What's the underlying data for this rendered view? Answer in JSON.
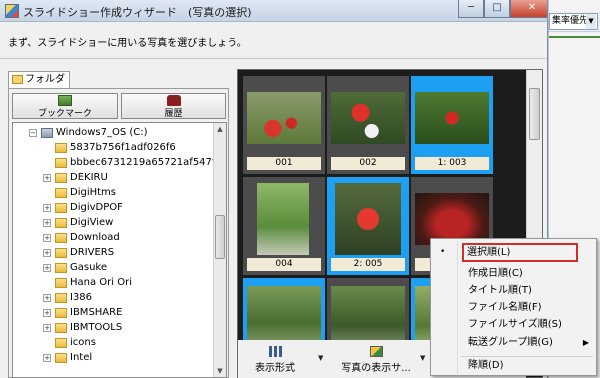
{
  "window": {
    "title": "スライドショー作成ウィザード　(写真の選択)",
    "minimize": "─",
    "restore": "□",
    "close": "✕"
  },
  "instruction": "まず、スライドショーに用いる写真を選びましょう。",
  "left_panel": {
    "tab_label": "フォルダ",
    "bookmark_label": "ブックマーク",
    "history_label": "履歴",
    "tree": {
      "drive": "Windows7_OS (C:)",
      "items": [
        "5837b756f1adf026f6",
        "bbbec6731219a65721af547f",
        "DEKIRU",
        "DigiHtms",
        "DigivDPOF",
        "DigiView",
        "Download",
        "DRIVERS",
        "Gasuke",
        "Hana Ori Ori",
        "I386",
        "IBMSHARE",
        "IBMTOOLS",
        "icons",
        "Intel"
      ]
    }
  },
  "photos": [
    {
      "caption": "001",
      "selected": false
    },
    {
      "caption": "002",
      "selected": false
    },
    {
      "caption": "1: 003",
      "selected": true
    },
    {
      "caption": "004",
      "selected": false
    },
    {
      "caption": "2: 005",
      "selected": true
    },
    {
      "caption": "",
      "selected": false
    },
    {
      "caption": "",
      "selected": true
    },
    {
      "caption": "",
      "selected": false
    },
    {
      "caption": "",
      "selected": true
    }
  ],
  "bottom_bar": {
    "view_mode_label": "表示形式",
    "photo_display_label": "写真の表示サ..."
  },
  "context_menu": {
    "items": [
      {
        "label": "選択順(L)",
        "bullet": "•",
        "highlighted": true
      },
      {
        "label": "作成日順(C)"
      },
      {
        "label": "タイトル順(T)"
      },
      {
        "label": "ファイル名順(F)"
      },
      {
        "label": "ファイルサイズ順(S)"
      },
      {
        "label": "転送グループ順(G)",
        "submenu": "▶"
      },
      {
        "label": "降順(D)"
      }
    ]
  },
  "background_app": {
    "select_value": "集率優先"
  },
  "colors": {
    "selection_blue": "#1ea0f2",
    "highlight_red": "#d62b2b",
    "photo_area_bg": "#1c1c1c"
  }
}
